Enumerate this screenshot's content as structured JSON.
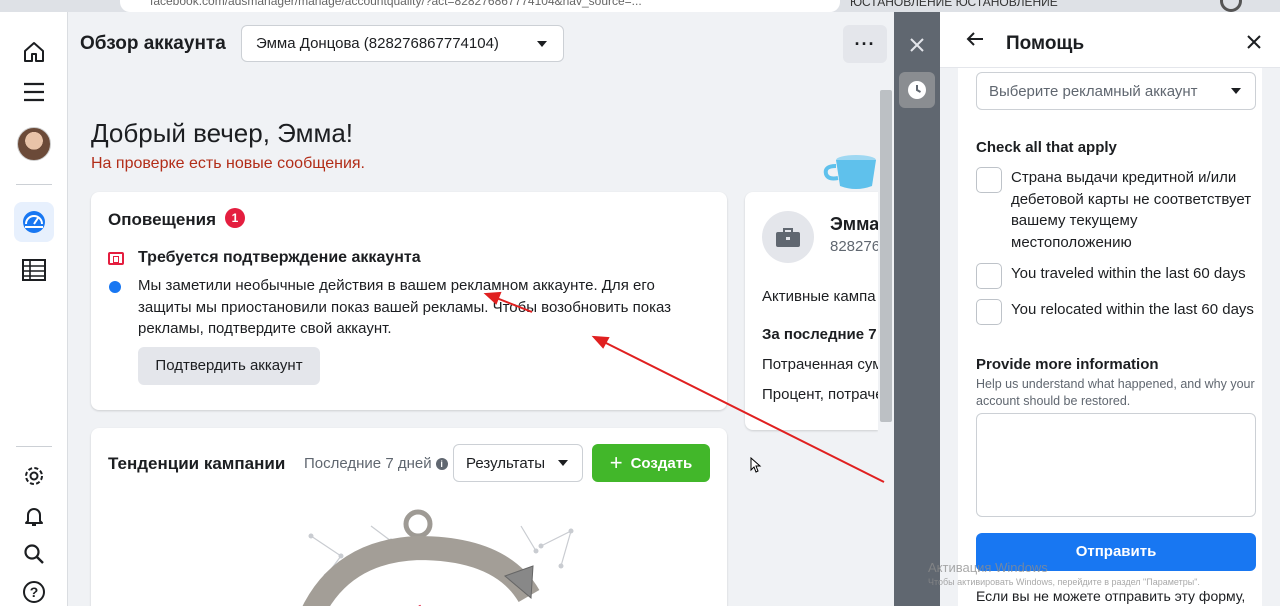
{
  "browser": {
    "url": "facebook.com/adsmanager/manage/accountquality/?act=828276867774104&nav_source=...",
    "right_text": "ЮСТАНОВЛЕНИЕ  ЮСТАНОВЛЕНИЕ"
  },
  "nav": {
    "items": [
      {
        "name": "home-icon"
      },
      {
        "name": "menu-icon"
      },
      {
        "name": "avatar"
      },
      {
        "name": "dashboard-icon"
      },
      {
        "name": "table-icon"
      },
      {
        "name": "gear-icon"
      },
      {
        "name": "bell-icon"
      },
      {
        "name": "search-icon"
      },
      {
        "name": "help-icon"
      }
    ]
  },
  "header": {
    "title": "Обзор аккаунта",
    "account_selected": "Эмма Донцова (828276867774104)",
    "more_label": "···"
  },
  "greeting": {
    "title": "Добрый вечер, Эмма!",
    "subtitle": "На проверке есть новые сообщения."
  },
  "alerts": {
    "heading": "Оповещения",
    "count": "1",
    "title": "Требуется подтверждение аккаунта",
    "body": "Мы заметили необычные действия в вашем рекламном аккаунте. Для его защиты мы приостановили показ вашей рекламы. Чтобы возобновить показ рекламы, подтвердите свой аккаунт.",
    "button": "Подтвердить аккаунт"
  },
  "summary": {
    "name": "Эмма",
    "id": "828276",
    "active_campaigns": "Активные кампа",
    "last_period": "За последние 7",
    "spent": "Потраченная сум",
    "percent": "Процент, потраче"
  },
  "trends": {
    "title": "Тенденции кампании",
    "period": "Последние 7 дней",
    "info": "i",
    "results": "Результаты",
    "create": "Создать",
    "create_icon": "+"
  },
  "help_panel": {
    "title": "Помощь",
    "ad_account_placeholder": "Выберите рекламный аккаунт",
    "check_title": "Check all that apply",
    "checks": [
      {
        "label": "Страна выдачи кредитной и/или дебетовой карты не соответствует вашему текущему местоположению"
      },
      {
        "label": "You traveled within the last 60 days"
      },
      {
        "label": "You relocated within the last 60 days"
      }
    ],
    "more_info_title": "Provide more information",
    "more_info_help": "Help us understand what happened, and why your account should be restored.",
    "submit": "Отправить",
    "footer": "Если вы не можете отправить эту форму,"
  },
  "watermark": {
    "title": "Активация Windows",
    "subtitle": "Чтобы активировать Windows, перейдите в раздел \"Параметры\"."
  },
  "colors": {
    "accent_blue": "#1877f2",
    "create_green": "#42b72a",
    "alert_red": "#e41e3f",
    "annotation_red": "#e02020",
    "review_text": "#b22d18"
  }
}
